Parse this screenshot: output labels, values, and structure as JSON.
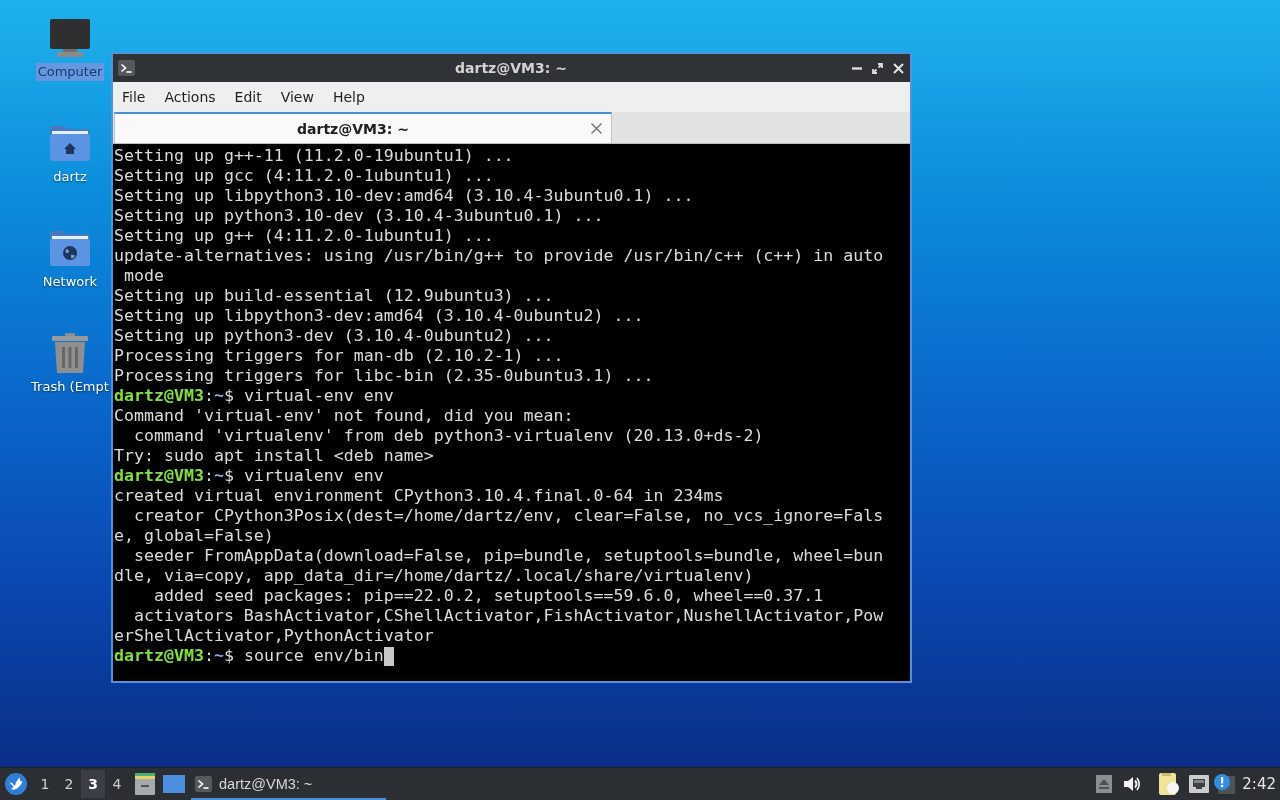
{
  "desktop_icons": [
    {
      "kind": "computer",
      "label": "Computer",
      "selected": true
    },
    {
      "kind": "home",
      "label": "dartz",
      "selected": false
    },
    {
      "kind": "network",
      "label": "Network",
      "selected": false
    },
    {
      "kind": "trash",
      "label": "Trash (Empt",
      "selected": false
    }
  ],
  "window": {
    "title": "dartz@VM3: ~",
    "menu": [
      "File",
      "Actions",
      "Edit",
      "View",
      "Help"
    ],
    "tabs": [
      {
        "label": "dartz@VM3: ~",
        "selected": true
      }
    ],
    "terminal": {
      "cursor": true,
      "lines": [
        {
          "kind": "output",
          "text": "Setting up g++-11 (11.2.0-19ubuntu1) ..."
        },
        {
          "kind": "output",
          "text": "Setting up gcc (4:11.2.0-1ubuntu1) ..."
        },
        {
          "kind": "output",
          "text": "Setting up libpython3.10-dev:amd64 (3.10.4-3ubuntu0.1) ..."
        },
        {
          "kind": "output",
          "text": "Setting up python3.10-dev (3.10.4-3ubuntu0.1) ..."
        },
        {
          "kind": "output",
          "text": "Setting up g++ (4:11.2.0-1ubuntu1) ..."
        },
        {
          "kind": "output",
          "text": "update-alternatives: using /usr/bin/g++ to provide /usr/bin/c++ (c++) in auto"
        },
        {
          "kind": "output",
          "text": " mode"
        },
        {
          "kind": "output",
          "text": "Setting up build-essential (12.9ubuntu3) ..."
        },
        {
          "kind": "output",
          "text": "Setting up libpython3-dev:amd64 (3.10.4-0ubuntu2) ..."
        },
        {
          "kind": "output",
          "text": "Setting up python3-dev (3.10.4-0ubuntu2) ..."
        },
        {
          "kind": "output",
          "text": "Processing triggers for man-db (2.10.2-1) ..."
        },
        {
          "kind": "output",
          "text": "Processing triggers for libc-bin (2.35-0ubuntu3.1) ..."
        },
        {
          "kind": "prompt",
          "user": "dartz@VM3",
          "separator": ":",
          "path": "~",
          "text": "$ virtual-env env"
        },
        {
          "kind": "output",
          "text": "Command 'virtual-env' not found, did you mean:"
        },
        {
          "kind": "output",
          "text": "  command 'virtualenv' from deb python3-virtualenv (20.13.0+ds-2)"
        },
        {
          "kind": "output",
          "text": "Try: sudo apt install <deb name>"
        },
        {
          "kind": "prompt",
          "user": "dartz@VM3",
          "separator": ":",
          "path": "~",
          "text": "$ virtualenv env"
        },
        {
          "kind": "output",
          "text": "created virtual environment CPython3.10.4.final.0-64 in 234ms"
        },
        {
          "kind": "output",
          "text": "  creator CPython3Posix(dest=/home/dartz/env, clear=False, no_vcs_ignore=Fals"
        },
        {
          "kind": "output",
          "text": "e, global=False)"
        },
        {
          "kind": "output",
          "text": "  seeder FromAppData(download=False, pip=bundle, setuptools=bundle, wheel=bun"
        },
        {
          "kind": "output",
          "text": "dle, via=copy, app_data_dir=/home/dartz/.local/share/virtualenv)"
        },
        {
          "kind": "output",
          "text": "    added seed packages: pip==22.0.2, setuptools==59.6.0, wheel==0.37.1"
        },
        {
          "kind": "output",
          "text": "  activators BashActivator,CShellActivator,FishActivator,NushellActivator,Pow"
        },
        {
          "kind": "output",
          "text": "erShellActivator,PythonActivator"
        },
        {
          "kind": "prompt",
          "user": "dartz@VM3",
          "separator": ":",
          "path": "~",
          "text": "$ source env/bin"
        }
      ]
    }
  },
  "taskbar": {
    "workspaces": [
      {
        "label": "1",
        "selected": false
      },
      {
        "label": "2",
        "selected": false
      },
      {
        "label": "3",
        "selected": true
      },
      {
        "label": "4",
        "selected": false
      }
    ],
    "tasks": [
      {
        "label": "dartz@VM3: ~",
        "selected": true
      }
    ],
    "clock": "2:42"
  }
}
